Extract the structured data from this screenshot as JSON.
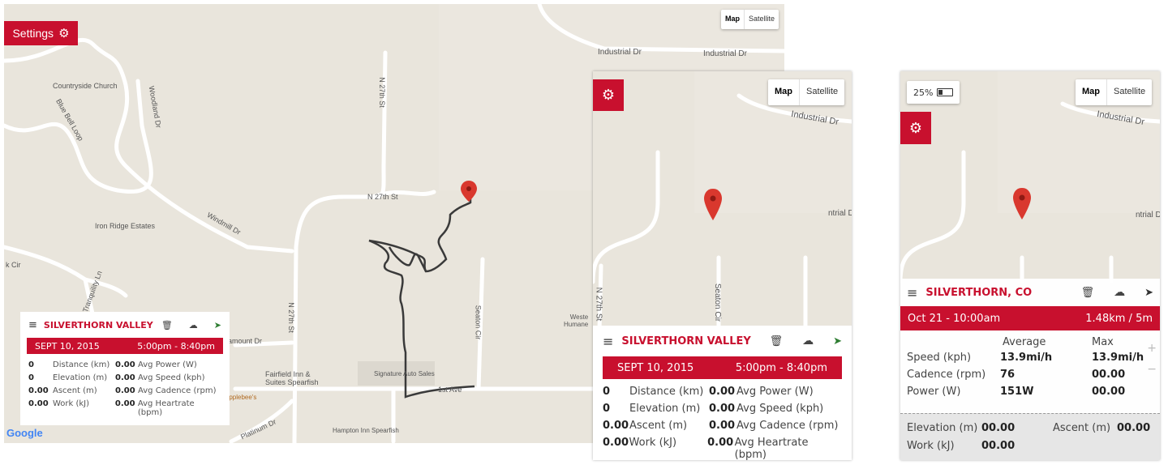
{
  "maptype": {
    "map": "Map",
    "satellite": "Satellite"
  },
  "desktop": {
    "settings_label": "Settings",
    "labels": {
      "industrial_1": "Industrial Dr",
      "industrial_2": "Industrial Dr",
      "countryside": "Countryside Church",
      "woodland": "Woodland Dr",
      "bluebell": "Blue Bell Loop",
      "n27_top": "N 27th St",
      "n27_mid": "N 27th St",
      "n27_bottom": "N 27th St",
      "iron_ridge": "Iron Ridge Estates",
      "windmill": "Windmill Dr",
      "kcir": "k Cir",
      "tranquility": "Tranquility Ln",
      "seaton": "Seaton Cir",
      "west_humane": "Weste\nHumane",
      "paramount": "aramount Dr",
      "fairfield": "Fairfield Inn &\nSuites Spearfish",
      "signature": "Signature Auto Sales",
      "applebees": "Applebee's",
      "first_ave": "1st Ave",
      "platinum": "Platinum Dr",
      "hampton": "Hampton Inn Spearfish",
      "google": "Google"
    },
    "ride": {
      "title": "SILVERTHORN VALLEY",
      "date": "SEPT 10, 2015",
      "time": "5:00pm - 8:40pm",
      "stats": [
        {
          "value": "0",
          "label": "Distance (km)",
          "value2": "0.00",
          "label2": "Avg Power (W)"
        },
        {
          "value": "0",
          "label": "Elevation (m)",
          "value2": "0.00",
          "label2": "Avg Speed (kph)"
        },
        {
          "value": "0.00",
          "label": "Ascent (m)",
          "value2": "0.00",
          "label2": "Avg Cadence (rpm)"
        },
        {
          "value": "0.00",
          "label": "Work (kJ)",
          "value2": "0.00",
          "label2": "Avg Heartrate (bpm)"
        }
      ]
    }
  },
  "tablet": {
    "labels": {
      "industrial": "Industrial Dr",
      "industrial_cut": "ntrial D",
      "n27": "N 27th St",
      "seaton": "Seaton Cir"
    },
    "ride": {
      "title": "SILVERTHORN VALLEY",
      "date": "SEPT 10, 2015",
      "time": "5:00pm - 8:40pm",
      "stats": [
        {
          "value": "0",
          "label": "Distance (km)",
          "value2": "0.00",
          "label2": "Avg Power (W)"
        },
        {
          "value": "0",
          "label": "Elevation (m)",
          "value2": "0.00",
          "label2": "Avg Speed (kph)"
        },
        {
          "value": "0.00",
          "label": "Ascent (m)",
          "value2": "0.00",
          "label2": "Avg Cadence (rpm)"
        },
        {
          "value": "0.00",
          "label": "Work (kJ)",
          "value2": "0.00",
          "label2": "Avg Heartrate (bpm)"
        }
      ]
    }
  },
  "phone": {
    "battery": "25%",
    "labels": {
      "industrial": "Industrial Dr",
      "industrial_cut": "ntrial D"
    },
    "ride": {
      "title": "SILVERTHORN, CO",
      "date": "Oct 21 - 10:00am",
      "distance": "1.48km / 5m",
      "col_avg": "Average",
      "col_max": "Max",
      "rows": [
        {
          "label": "Speed (kph)",
          "avg": "13.9mi/h",
          "max": "13.9mi/h"
        },
        {
          "label": "Cadence (rpm)",
          "avg": "76",
          "max": "00.00"
        },
        {
          "label": "Power (W)",
          "avg": "151W",
          "max": "00.00"
        }
      ],
      "elevation_label": "Elevation (m)",
      "elevation_value": "00.00",
      "ascent_label": "Ascent (m)",
      "ascent_value": "00.00",
      "work_label": "Work (kJ)",
      "work_value": "00.00",
      "zoom_in": "+",
      "zoom_out": "−"
    }
  },
  "colors": {
    "accent": "#c8102e",
    "map_bg": "#e9e5dc",
    "road": "#ffffff",
    "track": "#333333",
    "pin": "#d9382e"
  }
}
